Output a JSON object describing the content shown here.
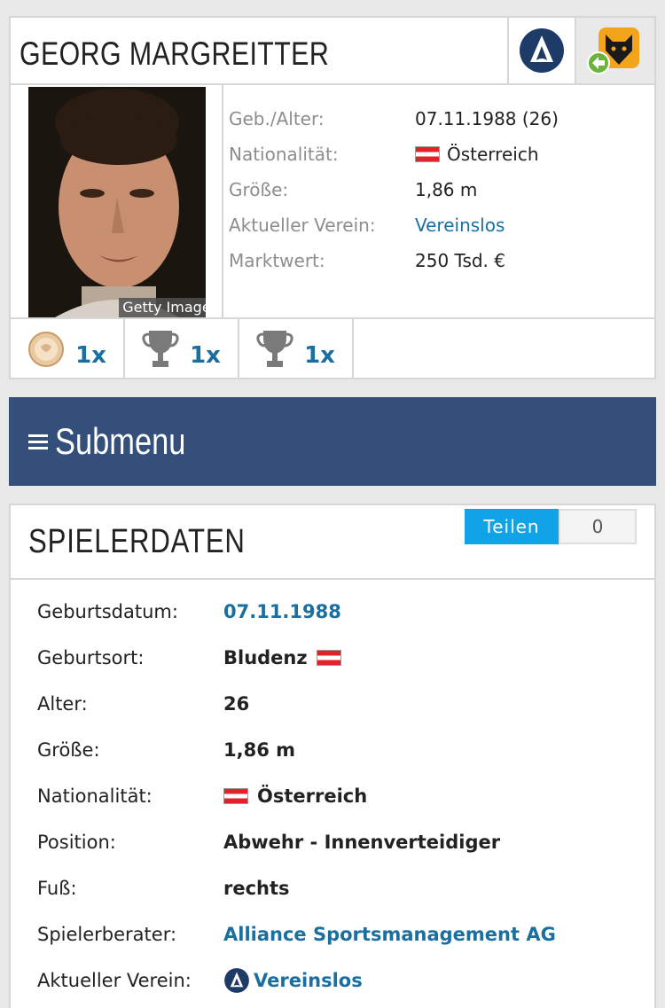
{
  "player": {
    "name": "GEORG MARGREITTER",
    "photo_credit": "Getty Images"
  },
  "club_icons": [
    "vereinslos-logo-icon",
    "wolves-logo-icon"
  ],
  "info": [
    {
      "label": "Geb./Alter:",
      "value": "07.11.1988 (26)"
    },
    {
      "label": "Nationalität:",
      "value": "Österreich"
    },
    {
      "label": "Größe:",
      "value": "1,86 m"
    },
    {
      "label": "Aktueller Verein:",
      "value": "Vereinslos"
    },
    {
      "label": "Marktwert:",
      "value": "250 Tsd. €"
    }
  ],
  "trophies": [
    {
      "icon": "medal-icon",
      "count": "1x"
    },
    {
      "icon": "trophy-icon",
      "count": "1x"
    },
    {
      "icon": "trophy-icon",
      "count": "1x"
    }
  ],
  "submenu": {
    "label": "Submenu"
  },
  "spielerdaten": {
    "title": "SPIELERDATEN",
    "share_label": "Teilen",
    "share_count": "0",
    "rows": [
      {
        "label": "Geburtsdatum:",
        "value": "07.11.1988"
      },
      {
        "label": "Geburtsort:",
        "value": "Bludenz"
      },
      {
        "label": "Alter:",
        "value": "26"
      },
      {
        "label": "Größe:",
        "value": "1,86 m"
      },
      {
        "label": "Nationalität:",
        "value": "Österreich"
      },
      {
        "label": "Position:",
        "value": "Abwehr - Innenverteidiger"
      },
      {
        "label": "Fuß:",
        "value": "rechts"
      },
      {
        "label": "Spielerberater:",
        "value": "Alliance Sportsmanagement AG"
      },
      {
        "label": "Aktueller Verein:",
        "value": "Vereinslos"
      }
    ]
  },
  "colors": {
    "link": "#1a6fa0",
    "submenu_bg": "#344f7a",
    "share_btn": "#10a3e8"
  }
}
